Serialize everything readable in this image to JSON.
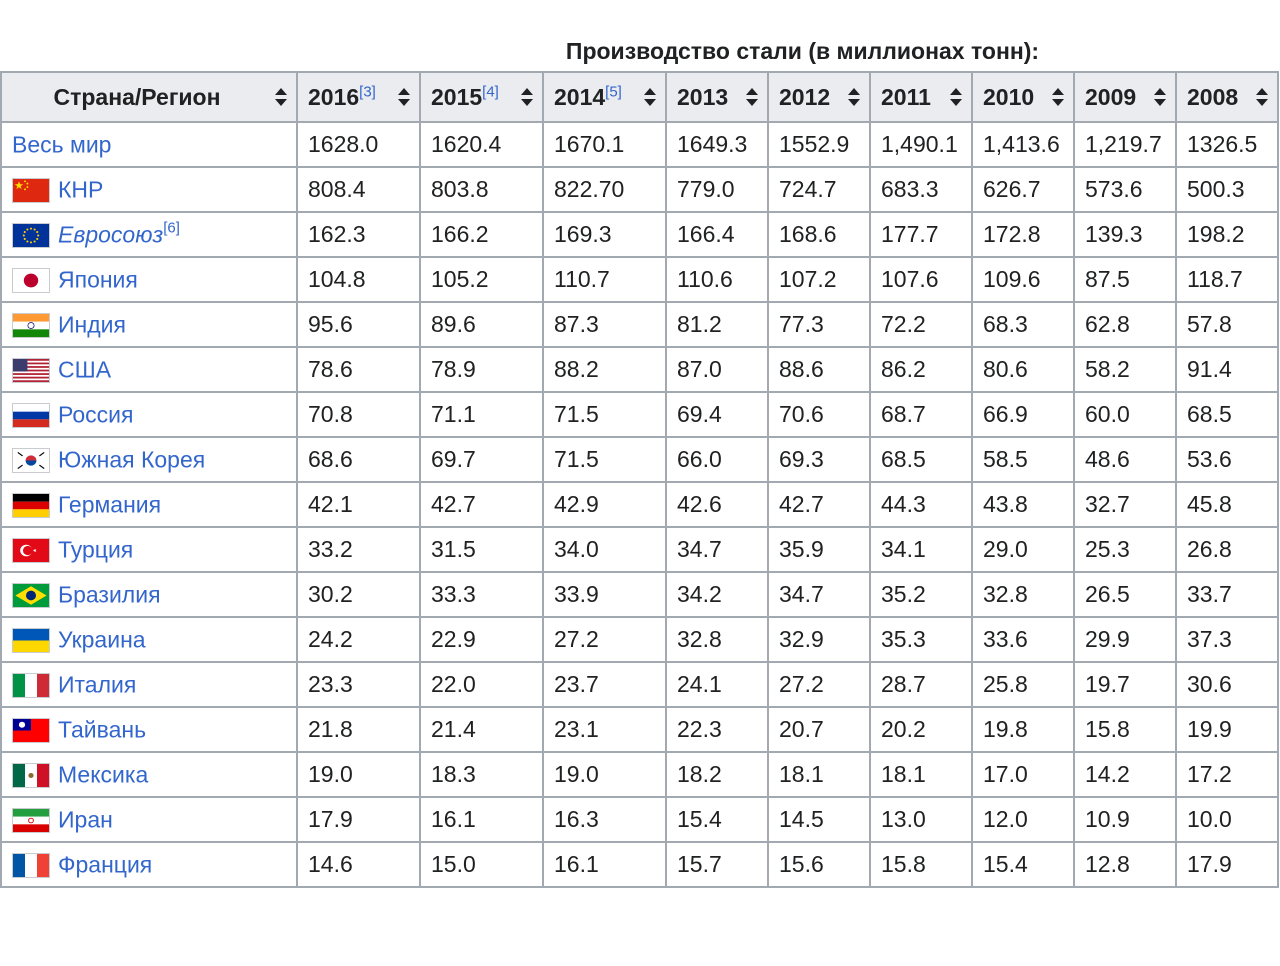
{
  "caption": "Производство стали (в миллионах тонн):",
  "chart_data": {
    "type": "table",
    "title": "Производство стали (в миллионах тонн):",
    "columns": [
      {
        "label": "Страна/Регион",
        "ref": ""
      },
      {
        "label": "2016",
        "ref": "[3]"
      },
      {
        "label": "2015",
        "ref": "[4]"
      },
      {
        "label": "2014",
        "ref": "[5]"
      },
      {
        "label": "2013",
        "ref": ""
      },
      {
        "label": "2012",
        "ref": ""
      },
      {
        "label": "2011",
        "ref": ""
      },
      {
        "label": "2010",
        "ref": ""
      },
      {
        "label": "2009",
        "ref": ""
      },
      {
        "label": "2008",
        "ref": ""
      }
    ],
    "rows": [
      {
        "name": "Весь мир",
        "ref": "",
        "italic": false,
        "flag": "",
        "values": [
          "1628.0",
          "1620.4",
          "1670.1",
          "1649.3",
          "1552.9",
          "1,490.1",
          "1,413.6",
          "1,219.7",
          "1326.5"
        ]
      },
      {
        "name": "КНР",
        "ref": "",
        "italic": false,
        "flag": "china",
        "values": [
          "808.4",
          "803.8",
          "822.70",
          "779.0",
          "724.7",
          "683.3",
          "626.7",
          "573.6",
          "500.3"
        ]
      },
      {
        "name": "Евросоюз",
        "ref": "[6]",
        "italic": true,
        "flag": "eu",
        "values": [
          "162.3",
          "166.2",
          "169.3",
          "166.4",
          "168.6",
          "177.7",
          "172.8",
          "139.3",
          "198.2"
        ]
      },
      {
        "name": "Япония",
        "ref": "",
        "italic": false,
        "flag": "japan",
        "values": [
          "104.8",
          "105.2",
          "110.7",
          "110.6",
          "107.2",
          "107.6",
          "109.6",
          "87.5",
          "118.7"
        ]
      },
      {
        "name": "Индия",
        "ref": "",
        "italic": false,
        "flag": "india",
        "values": [
          "95.6",
          "89.6",
          "87.3",
          "81.2",
          "77.3",
          "72.2",
          "68.3",
          "62.8",
          "57.8"
        ]
      },
      {
        "name": "США",
        "ref": "",
        "italic": false,
        "flag": "usa",
        "values": [
          "78.6",
          "78.9",
          "88.2",
          "87.0",
          "88.6",
          "86.2",
          "80.6",
          "58.2",
          "91.4"
        ]
      },
      {
        "name": "Россия",
        "ref": "",
        "italic": false,
        "flag": "russia",
        "values": [
          "70.8",
          "71.1",
          "71.5",
          "69.4",
          "70.6",
          "68.7",
          "66.9",
          "60.0",
          "68.5"
        ]
      },
      {
        "name": "Южная Корея",
        "ref": "",
        "italic": false,
        "flag": "south-korea",
        "values": [
          "68.6",
          "69.7",
          "71.5",
          "66.0",
          "69.3",
          "68.5",
          "58.5",
          "48.6",
          "53.6"
        ]
      },
      {
        "name": "Германия",
        "ref": "",
        "italic": false,
        "flag": "germany",
        "values": [
          "42.1",
          "42.7",
          "42.9",
          "42.6",
          "42.7",
          "44.3",
          "43.8",
          "32.7",
          "45.8"
        ]
      },
      {
        "name": "Турция",
        "ref": "",
        "italic": false,
        "flag": "turkey",
        "values": [
          "33.2",
          "31.5",
          "34.0",
          "34.7",
          "35.9",
          "34.1",
          "29.0",
          "25.3",
          "26.8"
        ]
      },
      {
        "name": "Бразилия",
        "ref": "",
        "italic": false,
        "flag": "brazil",
        "values": [
          "30.2",
          "33.3",
          "33.9",
          "34.2",
          "34.7",
          "35.2",
          "32.8",
          "26.5",
          "33.7"
        ]
      },
      {
        "name": "Украина",
        "ref": "",
        "italic": false,
        "flag": "ukraine",
        "values": [
          "24.2",
          "22.9",
          "27.2",
          "32.8",
          "32.9",
          "35.3",
          "33.6",
          "29.9",
          "37.3"
        ]
      },
      {
        "name": "Италия",
        "ref": "",
        "italic": false,
        "flag": "italy",
        "values": [
          "23.3",
          "22.0",
          "23.7",
          "24.1",
          "27.2",
          "28.7",
          "25.8",
          "19.7",
          "30.6"
        ]
      },
      {
        "name": "Тайвань",
        "ref": "",
        "italic": false,
        "flag": "taiwan",
        "values": [
          "21.8",
          "21.4",
          "23.1",
          "22.3",
          "20.7",
          "20.2",
          "19.8",
          "15.8",
          "19.9"
        ]
      },
      {
        "name": "Мексика",
        "ref": "",
        "italic": false,
        "flag": "mexico",
        "values": [
          "19.0",
          "18.3",
          "19.0",
          "18.2",
          "18.1",
          "18.1",
          "17.0",
          "14.2",
          "17.2"
        ]
      },
      {
        "name": "Иран",
        "ref": "",
        "italic": false,
        "flag": "iran",
        "values": [
          "17.9",
          "16.1",
          "16.3",
          "15.4",
          "14.5",
          "13.0",
          "12.0",
          "10.9",
          "10.0"
        ]
      },
      {
        "name": "Франция",
        "ref": "",
        "italic": false,
        "flag": "france",
        "values": [
          "14.6",
          "15.0",
          "16.1",
          "15.7",
          "15.6",
          "15.8",
          "15.4",
          "12.8",
          "17.9"
        ]
      }
    ]
  },
  "colors": {
    "link": "#3366cc",
    "header_bg": "#eaecf0",
    "border": "#a2a9b1",
    "text": "#202122"
  }
}
